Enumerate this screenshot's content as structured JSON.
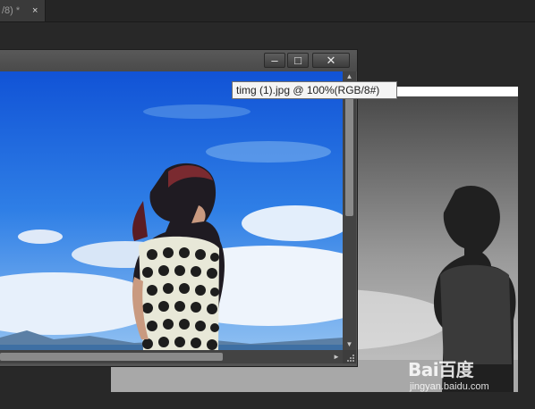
{
  "document_tab": {
    "label": "/8) *",
    "close_glyph": "×"
  },
  "front_window": {
    "minimize_glyph": "–",
    "maximize_glyph": "□",
    "close_glyph": "✕",
    "scroll_up_glyph": "▲",
    "scroll_down_glyph": "▼",
    "scroll_right_glyph": "►"
  },
  "tooltip": {
    "text": "timg (1).jpg @ 100%(RGB/8#)"
  },
  "watermark": {
    "logo": "Bai百度",
    "url": "jingyan.baidu.com"
  },
  "colors": {
    "app_bg": "#282828",
    "panel": "#535353",
    "sky_blue": "#1a63d8"
  }
}
